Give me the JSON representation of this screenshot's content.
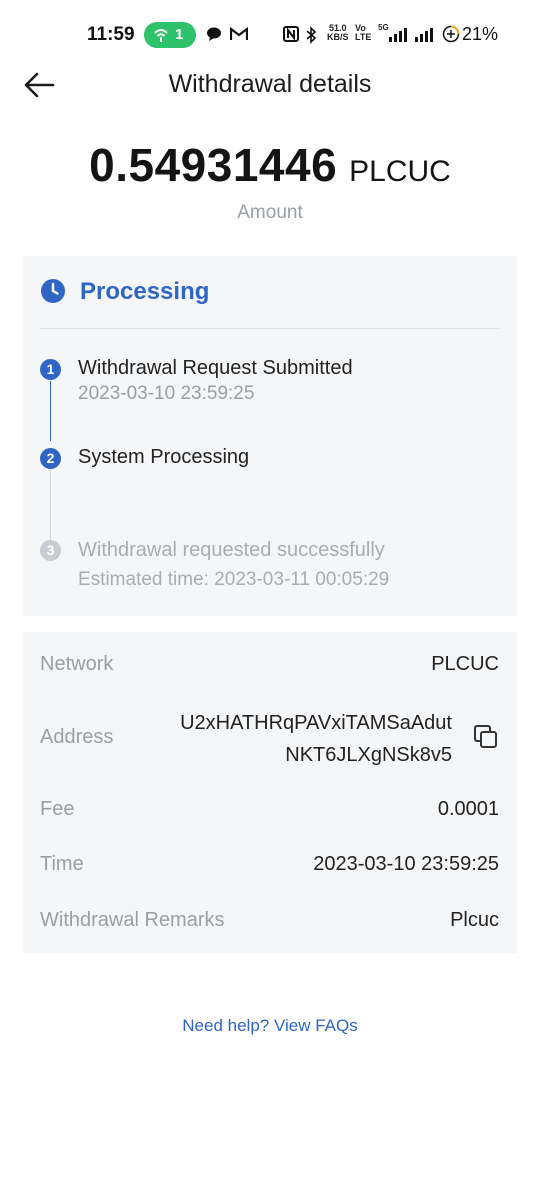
{
  "status_bar": {
    "time": "11:59",
    "hotspot_count": "1",
    "net_speed_value": "51.0",
    "net_speed_unit": "KB/S",
    "volte_top": "Vo",
    "volte_bottom": "LTE",
    "network_5g": "5G",
    "battery": "21%"
  },
  "header": {
    "title": "Withdrawal details"
  },
  "amount": {
    "value": "0.54931446",
    "unit": "PLCUC",
    "label": "Amount"
  },
  "progress": {
    "status": "Processing",
    "steps": [
      {
        "num": "1",
        "title": "Withdrawal Request Submitted",
        "subtitle": "2023-03-10 23:59:25",
        "state": "done"
      },
      {
        "num": "2",
        "title": "System Processing",
        "subtitle": "",
        "state": "active"
      },
      {
        "num": "3",
        "title": "Withdrawal requested successfully",
        "subtitle": "Estimated time: 2023-03-11 00:05:29",
        "state": "pending"
      }
    ]
  },
  "details": {
    "network_label": "Network",
    "network_value": "PLCUC",
    "address_label": "Address",
    "address_line1": "U2xHATHRqPAVxiTAMSaAdut",
    "address_line2": "NKT6JLXgNSk8v5",
    "fee_label": "Fee",
    "fee_value": "0.0001",
    "time_label": "Time",
    "time_value": "2023-03-10 23:59:25",
    "remarks_label": "Withdrawal Remarks",
    "remarks_value": "Plcuc"
  },
  "help_link": "Need help? View FAQs",
  "colors": {
    "accent": "#2f66c5",
    "muted_text": "#9a9ea5",
    "card_bg": "#f5f6f8",
    "pending_step": "#c9ccd1"
  }
}
